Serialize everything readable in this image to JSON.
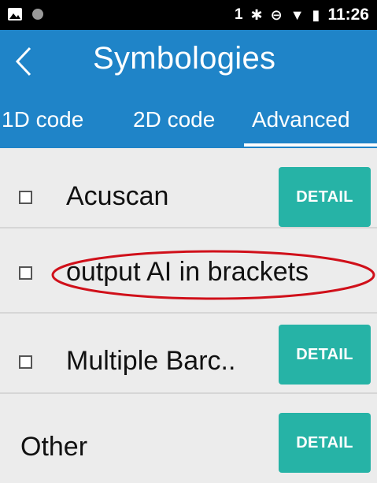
{
  "status_bar": {
    "left_icons": [
      "image-icon",
      "dot-icon"
    ],
    "sim_label": "1",
    "bluetooth_glyph": "✱",
    "do_not_disturb_glyph": "⊖",
    "wifi_glyph": "▼",
    "battery_glyph": "▮",
    "time": "11:26"
  },
  "app_bar": {
    "back_glyph": "<",
    "title": "Symbologies",
    "background": "#1f84c8"
  },
  "tabs": [
    {
      "label": "1D code",
      "selected": false
    },
    {
      "label": "2D code",
      "selected": false
    },
    {
      "label": "Advanced",
      "selected": true
    }
  ],
  "rows": [
    {
      "label": "Acuscan",
      "checked": false,
      "button": "DETAIL"
    },
    {
      "label": "output AI in brackets",
      "checked": false,
      "highlighted": true
    },
    {
      "label": "Multiple Barc..",
      "checked": false,
      "button": "DETAIL"
    },
    {
      "label": "Other",
      "button": "DETAIL"
    }
  ],
  "colors": {
    "accent": "#1f84c8",
    "button": "#26b3a6",
    "annotation": "#d0101a"
  }
}
